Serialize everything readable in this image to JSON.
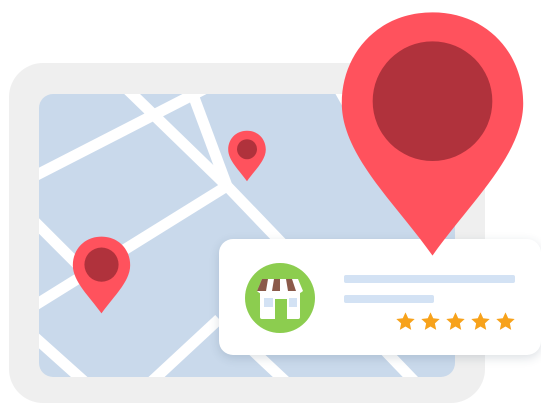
{
  "illustration": {
    "subject": "map-with-location-pins-and-store-review-card",
    "icons": [
      "location-pin-icon",
      "store-icon",
      "star-icon"
    ]
  },
  "colors": {
    "pin": "#ff525d",
    "pin_center": "#b0323c",
    "map_land": "#c9d9eb",
    "map_roads": "#ffffff",
    "device_frame": "#efefef",
    "store_badge": "#8ccd4f",
    "star": "#f7a21b",
    "placeholder_line": "#d3e2f4"
  },
  "review_card": {
    "rating": 5,
    "rating_max": 5
  }
}
